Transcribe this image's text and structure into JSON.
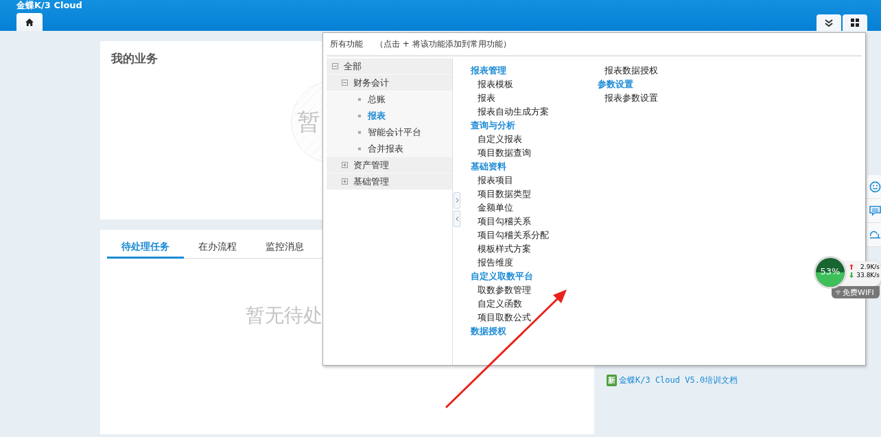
{
  "header": {
    "logo": "金蝶K/3 Cloud"
  },
  "my_business": {
    "title": "我的业务",
    "empty_mark": "暂"
  },
  "tasks": {
    "tabs": [
      {
        "label": "待处理任务",
        "selected": true
      },
      {
        "label": "在办流程",
        "selected": false
      },
      {
        "label": "监控消息",
        "selected": false
      }
    ],
    "empty_text": "暂无待处"
  },
  "news": [
    {
      "badge": "新",
      "title": "金蝶K/3 Cloud V5.0培训文档"
    }
  ],
  "popup": {
    "title": "所有功能",
    "hint": "（点击 + 将该功能添加到常用功能）",
    "tree": [
      {
        "label": "全部",
        "kind": "folder",
        "expanded": true,
        "selected": false,
        "children": [
          {
            "label": "财务会计",
            "kind": "folder",
            "expanded": true,
            "selected": false,
            "children": [
              {
                "label": "总账",
                "kind": "leaf",
                "selected": false
              },
              {
                "label": "报表",
                "kind": "leaf",
                "selected": true
              },
              {
                "label": "智能会计平台",
                "kind": "leaf",
                "selected": false
              },
              {
                "label": "合并报表",
                "kind": "leaf",
                "selected": false
              }
            ]
          },
          {
            "label": "资产管理",
            "kind": "folder",
            "expanded": false,
            "selected": false
          },
          {
            "label": "基础管理",
            "kind": "folder",
            "expanded": false,
            "selected": false
          }
        ]
      }
    ],
    "columns": [
      [
        {
          "kind": "heading",
          "label": "报表管理"
        },
        {
          "kind": "item",
          "label": "报表模板"
        },
        {
          "kind": "item",
          "label": "报表"
        },
        {
          "kind": "item",
          "label": "报表自动生成方案"
        },
        {
          "kind": "heading",
          "label": "查询与分析"
        },
        {
          "kind": "item",
          "label": "自定义报表"
        },
        {
          "kind": "item",
          "label": "项目数据查询"
        },
        {
          "kind": "heading",
          "label": "基础资料"
        },
        {
          "kind": "item",
          "label": "报表项目"
        },
        {
          "kind": "item",
          "label": "项目数据类型"
        },
        {
          "kind": "item",
          "label": "金额单位"
        },
        {
          "kind": "item",
          "label": "项目勾稽关系"
        },
        {
          "kind": "item",
          "label": "项目勾稽关系分配"
        },
        {
          "kind": "item",
          "label": "模板样式方案"
        },
        {
          "kind": "item",
          "label": "报告维度"
        },
        {
          "kind": "heading",
          "label": "自定义取数平台"
        },
        {
          "kind": "item",
          "label": "取数参数管理"
        },
        {
          "kind": "item",
          "label": "自定义函数"
        },
        {
          "kind": "item",
          "label": "项目取数公式"
        },
        {
          "kind": "heading",
          "label": "数据授权"
        }
      ],
      [
        {
          "kind": "item",
          "label": "报表数据授权"
        },
        {
          "kind": "heading",
          "label": "参数设置"
        },
        {
          "kind": "item",
          "label": "报表参数设置"
        }
      ]
    ]
  },
  "net_widget": {
    "percent": "53%",
    "upload": "2.9K/s",
    "download": "33.8K/s",
    "label": "免费WIFI"
  }
}
